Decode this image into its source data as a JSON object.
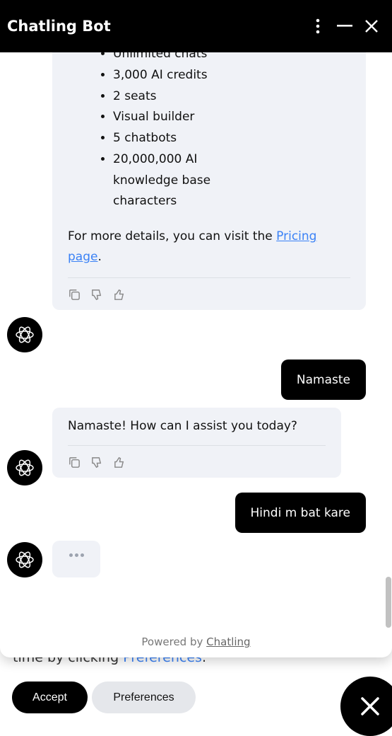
{
  "header": {
    "title": "Chatling Bot",
    "icons": [
      "more-vertical-icon",
      "minimize-icon",
      "close-icon"
    ]
  },
  "messages": [
    {
      "role": "bot",
      "list": [
        "Unlimited chats",
        "3,000 AI credits",
        "2 seats",
        "Visual builder",
        "5 chatbots",
        "20,000,000 AI knowledge base characters"
      ],
      "text_before": "For more details, you can visit the ",
      "link": "Pricing page",
      "text_after": "."
    },
    {
      "role": "user",
      "text": "Namaste"
    },
    {
      "role": "bot",
      "text": "Namaste! How can I assist you today?"
    },
    {
      "role": "user",
      "text": "Hindi m bat kare"
    }
  ],
  "footer": {
    "prefix": "Powered by ",
    "brand": "Chatling"
  },
  "cookie": {
    "text": "time by clicking ",
    "link": "Preferences",
    "end": ".",
    "accept": "Accept",
    "preferences": "Preferences"
  },
  "colors": {
    "accent": "#000000",
    "link": "#3b82f6",
    "bot_bubble": "#f0f2f7"
  }
}
